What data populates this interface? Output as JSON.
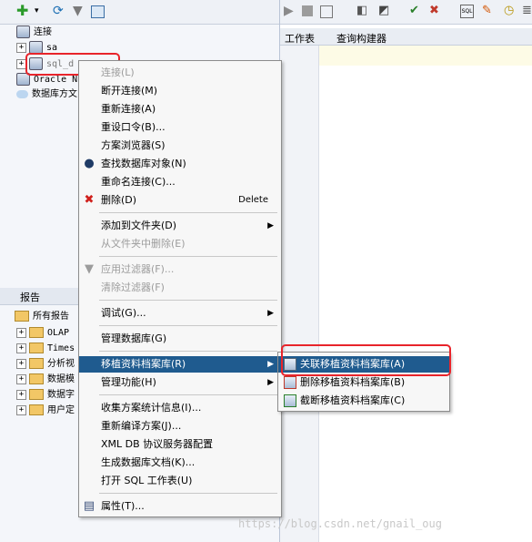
{
  "left_panel": {
    "tree": {
      "root_label": "连接",
      "items": [
        {
          "label": "sa"
        },
        {
          "label": "sql_d"
        },
        {
          "label": "Oracle N"
        },
        {
          "label": "数据库方文"
        }
      ]
    },
    "reports": {
      "header": "报告",
      "items": [
        {
          "label": "所有报告"
        },
        {
          "label": "OLAP"
        },
        {
          "label": "Times"
        },
        {
          "label": "分析视"
        },
        {
          "label": "数据模"
        },
        {
          "label": "数据字"
        },
        {
          "label": "用户定"
        }
      ]
    }
  },
  "right_panel": {
    "tabs": {
      "worksheet": "工作表",
      "query_builder": "查询构建器"
    }
  },
  "context_menu": {
    "items": [
      {
        "label": "连接(L)",
        "disabled": true
      },
      {
        "label": "断开连接(M)"
      },
      {
        "label": "重新连接(A)"
      },
      {
        "label": "重设口令(B)..."
      },
      {
        "label": "方案浏览器(S)"
      },
      {
        "label": "查找数据库对象(N)",
        "icon": "binoculars-icon"
      },
      {
        "label": "重命名连接(C)..."
      },
      {
        "label": "删除(D)",
        "shortcut": "Delete",
        "icon": "delete-x-icon"
      },
      {
        "label": "添加到文件夹(D)",
        "submenu": true
      },
      {
        "label": "从文件夹中删除(E)",
        "disabled": true
      },
      {
        "label": "应用过滤器(F)...",
        "disabled": true,
        "icon": "filter-icon"
      },
      {
        "label": "清除过滤器(F)",
        "disabled": true
      },
      {
        "label": "调试(G)...",
        "submenu": true
      },
      {
        "label": "管理数据库(G)"
      },
      {
        "label": "移植资料档案库(R)",
        "submenu": true,
        "selected": true
      },
      {
        "label": "管理功能(H)",
        "submenu": true
      },
      {
        "label": "收集方案统计信息(I)..."
      },
      {
        "label": "重新编译方案(J)..."
      },
      {
        "label": "XML DB 协议服务器配置"
      },
      {
        "label": "生成数据库文档(K)..."
      },
      {
        "label": "打开 SQL 工作表(U)"
      },
      {
        "label": "属性(T)...",
        "icon": "properties-icon"
      }
    ]
  },
  "submenu": {
    "items": [
      {
        "label": "关联移植资料档案库(A)",
        "selected": true
      },
      {
        "label": "删除移植资料档案库(B)"
      },
      {
        "label": "截断移植资料档案库(C)"
      }
    ]
  },
  "watermark": "https://blog.csdn.net/gnail_oug",
  "colors": {
    "selection": "#1f5b8f",
    "highlight_box": "#e8242b"
  }
}
